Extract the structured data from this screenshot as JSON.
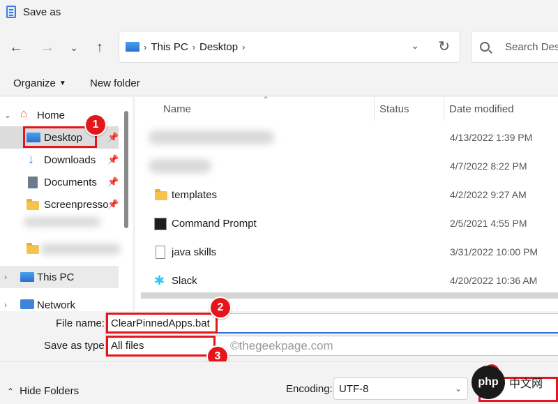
{
  "window": {
    "title": "Save as"
  },
  "nav": {
    "back_icon": "arrow-left-icon",
    "forward_icon": "arrow-right-icon",
    "recent_icon": "chevron-down-icon",
    "up_icon": "arrow-up-icon",
    "breadcrumb": [
      "This PC",
      "Desktop"
    ],
    "search_placeholder": "Search Desk"
  },
  "toolbar": {
    "organize": "Organize",
    "new_folder": "New folder"
  },
  "tree": {
    "home": "Home",
    "desktop": "Desktop",
    "downloads": "Downloads",
    "documents": "Documents",
    "screenpresso": "Screenpresso",
    "this_pc": "This PC",
    "network": "Network"
  },
  "columns": {
    "name": "Name",
    "status": "Status",
    "date": "Date modified"
  },
  "files": [
    {
      "name": "",
      "date": "4/13/2022 1:39 PM",
      "icon": "blurred-folder"
    },
    {
      "name": "",
      "date": "4/7/2022 8:22 PM",
      "icon": "blurred-folder"
    },
    {
      "name": "templates",
      "date": "4/2/2022 9:27 AM",
      "icon": "folder-icon"
    },
    {
      "name": "Command Prompt",
      "date": "2/5/2021 4:55 PM",
      "icon": "cmd-icon"
    },
    {
      "name": "java skills",
      "date": "3/31/2022 10:00 PM",
      "icon": "document-icon"
    },
    {
      "name": "Slack",
      "date": "4/20/2022 10:36 AM",
      "icon": "slack-icon"
    }
  ],
  "form": {
    "file_name_label": "File name:",
    "file_name_value": "ClearPinnedApps.bat",
    "type_label": "Save as type:",
    "type_value": "All files"
  },
  "annotations": {
    "badge1": "1",
    "badge2": "2",
    "badge3": "3",
    "watermark": "©thegeekpage.com",
    "accent": "#e2161b"
  },
  "footer": {
    "hide_folders": "Hide Folders",
    "encoding_label": "Encoding:",
    "encoding_value": "UTF-8",
    "logo_php": "php",
    "logo_cn": "中文网"
  }
}
